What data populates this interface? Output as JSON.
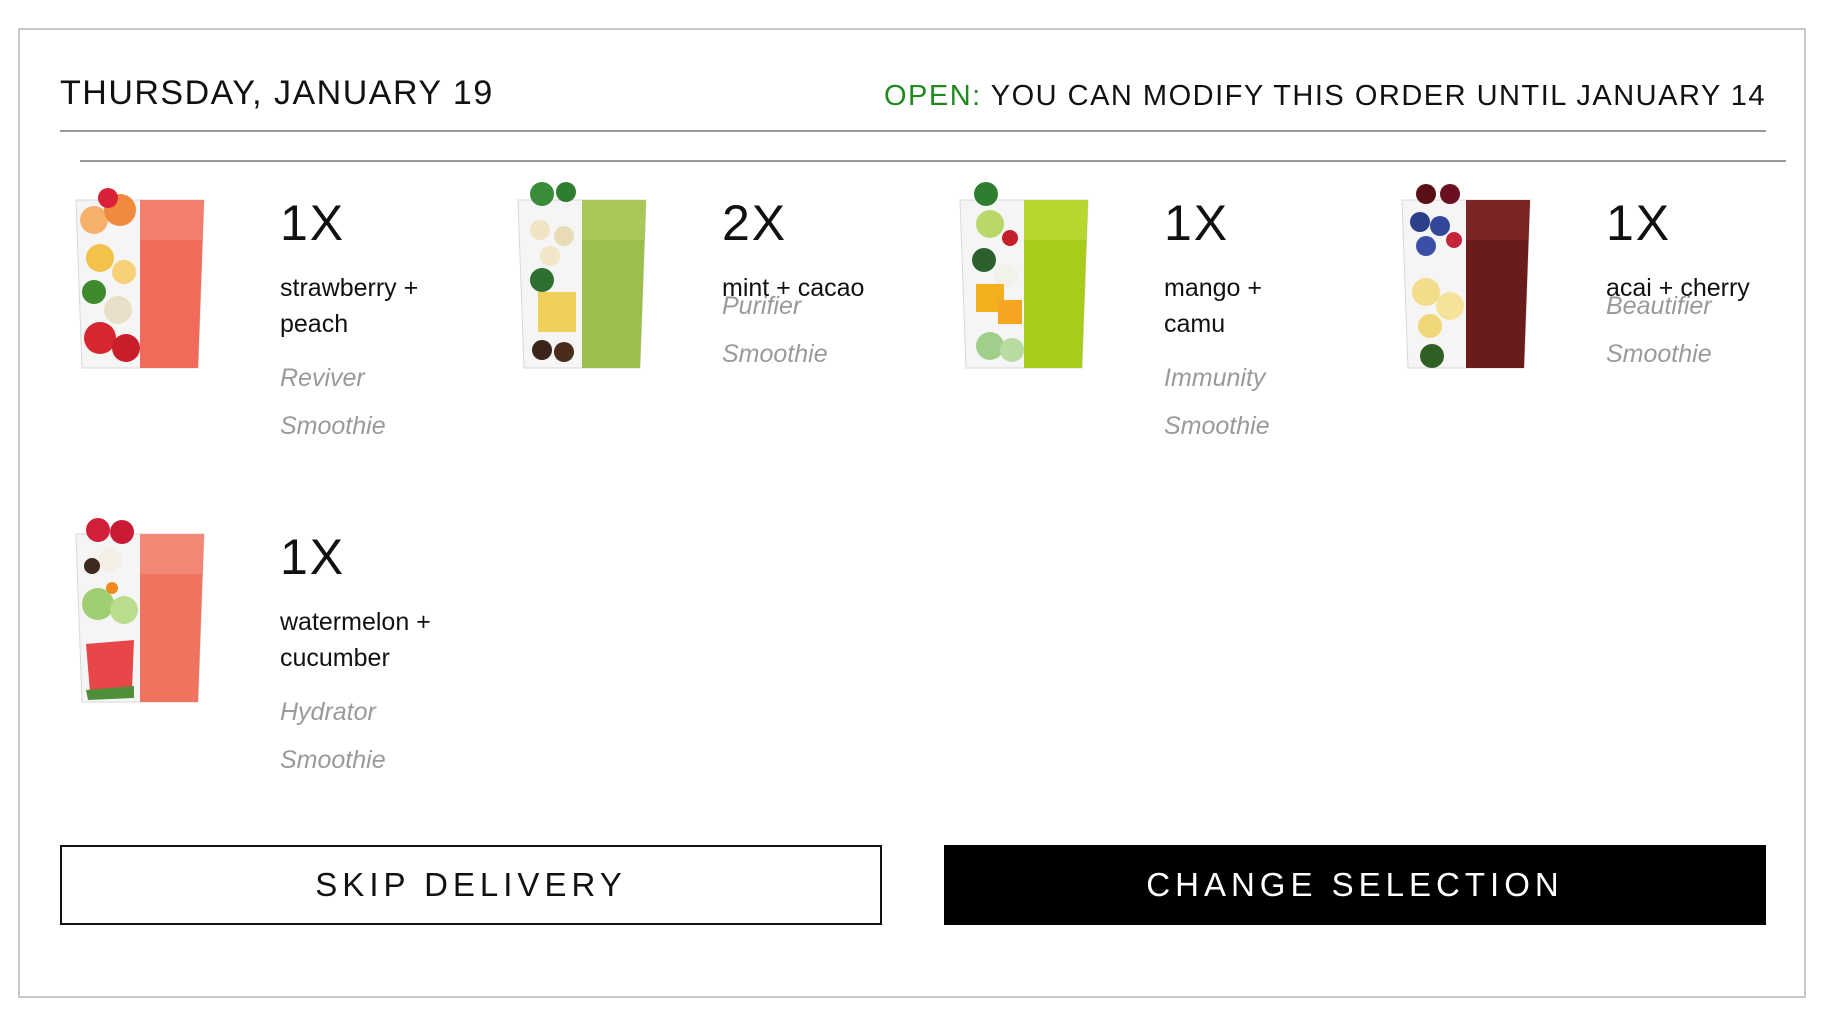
{
  "header": {
    "date": "THURSDAY, JANUARY 19",
    "status_label": "OPEN:",
    "status_text": " YOU CAN MODIFY THIS ORDER UNTIL JANUARY 14",
    "status_color": "#1f8a1f"
  },
  "items": [
    {
      "qty": "1X",
      "name_line1": "strawberry +",
      "name_line2": "peach",
      "category": "Reviver",
      "type": "Smoothie",
      "image": "strawberry-peach-smoothie-glass",
      "smoothie_color": "#f26a5a"
    },
    {
      "qty": "2X",
      "name_line1": "mint + cacao",
      "name_line2": "",
      "category": "Purifier",
      "type": "Smoothie",
      "image": "mint-cacao-smoothie-glass",
      "smoothie_color": "#9bbf4a"
    },
    {
      "qty": "1X",
      "name_line1": "mango +",
      "name_line2": "camu",
      "category": "Immunity",
      "type": "Smoothie",
      "image": "mango-camu-smoothie-glass",
      "smoothie_color": "#a8cc1c"
    },
    {
      "qty": "1X",
      "name_line1": "acai + cherry",
      "name_line2": "",
      "category": "Beautifier",
      "type": "Smoothie",
      "image": "acai-cherry-smoothie-glass",
      "smoothie_color": "#6a1c1c"
    },
    {
      "qty": "1X",
      "name_line1": "watermelon +",
      "name_line2": "cucumber",
      "category": "Hydrator",
      "type": "Smoothie",
      "image": "watermelon-cucumber-smoothie-glass",
      "smoothie_color": "#f0735f"
    }
  ],
  "buttons": {
    "skip": "SKIP DELIVERY",
    "change": "CHANGE SELECTION"
  }
}
